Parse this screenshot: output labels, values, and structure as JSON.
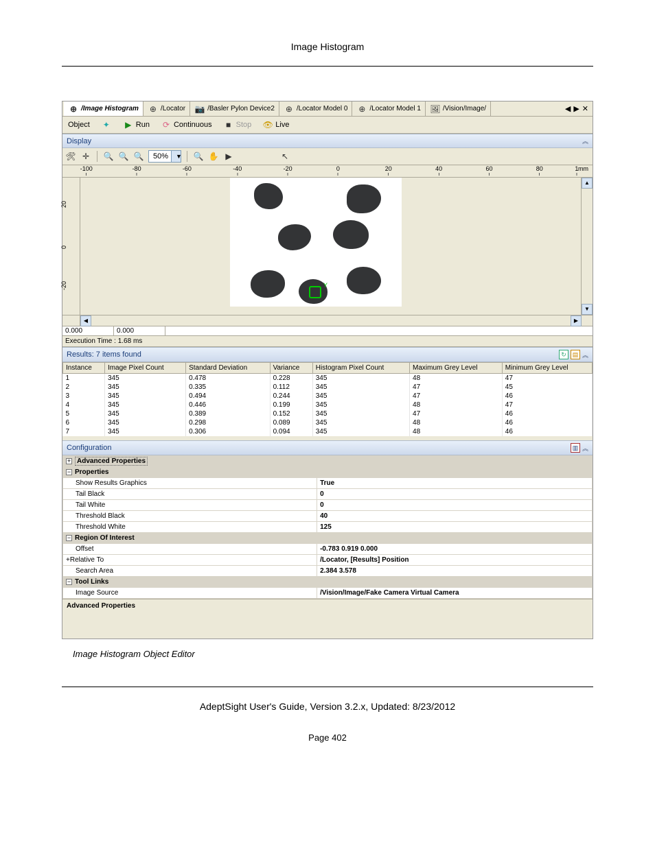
{
  "doc": {
    "header": "Image Histogram",
    "caption": "Image Histogram Object Editor",
    "footer": "AdeptSight User's Guide,  Version 3.2.x, Updated: 8/23/2012",
    "page": "Page 402"
  },
  "tabs": [
    {
      "label": "/Image Histogram",
      "active": true
    },
    {
      "label": "/Locator"
    },
    {
      "label": "/Basler Pylon Device2"
    },
    {
      "label": "/Locator Model 0"
    },
    {
      "label": "/Locator Model 1"
    },
    {
      "label": "/Vision/Image/"
    }
  ],
  "objbar": {
    "object": "Object",
    "run": "Run",
    "cont": "Continuous",
    "stop": "Stop",
    "live": "Live"
  },
  "display": {
    "title": "Display",
    "zoom": "50%",
    "ruler_unit": "mm",
    "ticks_h": [
      "-100",
      "-80",
      "-60",
      "-40",
      "-20",
      "0",
      "20",
      "40",
      "60",
      "80",
      "1"
    ],
    "ticks_v": [
      "20",
      "0",
      "-20"
    ]
  },
  "status": {
    "x": "0.000",
    "y": "0.000"
  },
  "exec": "Execution Time : 1.68 ms",
  "results": {
    "title": "Results: 7 items found",
    "cols": [
      "Instance",
      "Image Pixel Count",
      "Standard Deviation",
      "Variance",
      "Histogram Pixel Count",
      "Maximum Grey Level",
      "Minimum Grey Level"
    ],
    "rows": [
      [
        "1",
        "345",
        "0.478",
        "0.228",
        "345",
        "48",
        "47"
      ],
      [
        "2",
        "345",
        "0.335",
        "0.112",
        "345",
        "47",
        "45"
      ],
      [
        "3",
        "345",
        "0.494",
        "0.244",
        "345",
        "47",
        "46"
      ],
      [
        "4",
        "345",
        "0.446",
        "0.199",
        "345",
        "48",
        "47"
      ],
      [
        "5",
        "345",
        "0.389",
        "0.152",
        "345",
        "47",
        "46"
      ],
      [
        "6",
        "345",
        "0.298",
        "0.089",
        "345",
        "48",
        "46"
      ],
      [
        "7",
        "345",
        "0.306",
        "0.094",
        "345",
        "48",
        "46"
      ]
    ]
  },
  "config": {
    "title": "Configuration",
    "advprop": "Advanced Properties",
    "props_cat": "Properties",
    "roi_cat": "Region Of Interest",
    "tool_cat": "Tool Links",
    "desc": "Advanced Properties",
    "rows": {
      "show_results": {
        "k": "Show Results Graphics",
        "v": "True"
      },
      "tail_black": {
        "k": "Tail Black",
        "v": "0"
      },
      "tail_white": {
        "k": "Tail White",
        "v": "0"
      },
      "thr_black": {
        "k": "Threshold Black",
        "v": "40"
      },
      "thr_white": {
        "k": "Threshold White",
        "v": "125"
      },
      "offset": {
        "k": "Offset",
        "v": "-0.783 0.919 0.000"
      },
      "relative": {
        "k": "Relative To",
        "v": "/Locator, [Results] Position"
      },
      "search": {
        "k": "Search Area",
        "v": "2.384 3.578"
      },
      "imgsrc": {
        "k": "Image Source",
        "v": "/Vision/Image/Fake Camera Virtual Camera"
      }
    }
  }
}
